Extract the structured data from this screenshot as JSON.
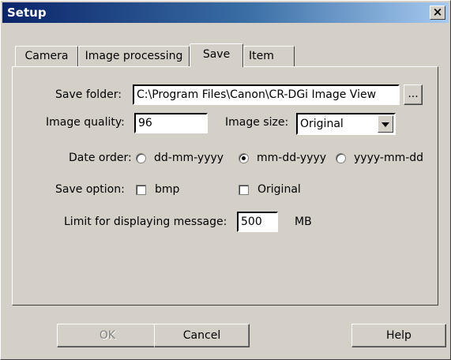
{
  "window": {
    "title": "Setup",
    "close_glyph": "×"
  },
  "tabs": [
    {
      "label": "Camera"
    },
    {
      "label": "Image processing"
    },
    {
      "label": "Save",
      "active": true
    },
    {
      "label": "Item"
    }
  ],
  "save": {
    "folder_label": "Save folder:",
    "folder_value": "C:\\Program Files\\Canon\\CR-DGi Image View",
    "browse_label": "...",
    "quality_label": "Image quality:",
    "quality_value": "96",
    "size_label": "Image size:",
    "size_value": "Original",
    "date_order_label": "Date order:",
    "date_options": [
      {
        "label": "dd-mm-yyyy",
        "selected": false
      },
      {
        "label": "mm-dd-yyyy",
        "selected": true
      },
      {
        "label": "yyyy-mm-dd",
        "selected": false
      }
    ],
    "save_option_label": "Save option:",
    "option_bmp": "bmp",
    "option_original": "Original",
    "limit_label": "Limit for displaying message:",
    "limit_value": "500",
    "limit_unit": "MB"
  },
  "buttons": {
    "ok": "OK",
    "cancel": "Cancel",
    "help": "Help"
  }
}
